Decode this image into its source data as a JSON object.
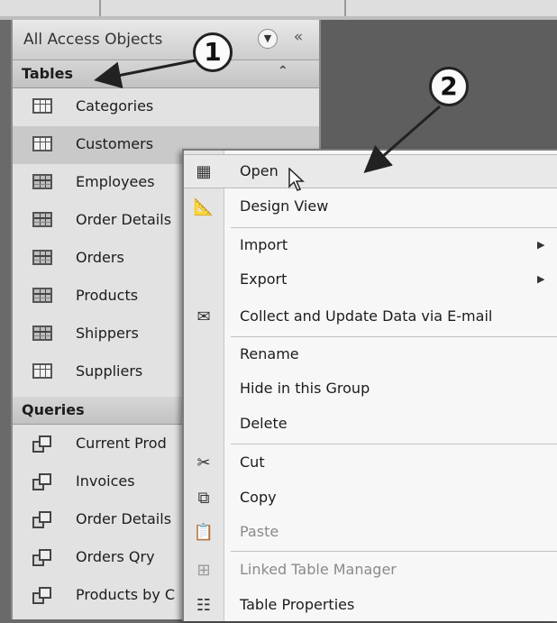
{
  "nav": {
    "title": "All Access Objects",
    "dropdown_icon": "chevron-down-circle-icon",
    "close_icon": "double-chevron-left-icon",
    "groups": [
      {
        "label": "Tables",
        "collapse_icon": "double-chevron-up-icon",
        "items": [
          {
            "label": "Categories",
            "icon": "table-icon"
          },
          {
            "label": "Customers",
            "icon": "table-icon"
          },
          {
            "label": "Employees",
            "icon": "table-icon"
          },
          {
            "label": "Order Details",
            "icon": "table-icon"
          },
          {
            "label": "Orders",
            "icon": "table-icon"
          },
          {
            "label": "Products",
            "icon": "table-icon"
          },
          {
            "label": "Shippers",
            "icon": "table-icon"
          },
          {
            "label": "Suppliers",
            "icon": "table-icon"
          }
        ]
      },
      {
        "label": "Queries",
        "items": [
          {
            "label": "Current Prod",
            "icon": "query-icon"
          },
          {
            "label": "Invoices",
            "icon": "query-icon"
          },
          {
            "label": "Order Details",
            "icon": "query-icon"
          },
          {
            "label": "Orders Qry",
            "icon": "query-icon"
          },
          {
            "label": "Products by C",
            "icon": "query-icon"
          }
        ]
      }
    ],
    "selected_item": "Customers"
  },
  "context_menu": {
    "items": [
      {
        "label": "Open",
        "icon": "open-table-icon",
        "highlighted": true
      },
      {
        "label": "Design View",
        "icon": "design-view-icon"
      },
      {
        "label": "Import",
        "submenu": true
      },
      {
        "label": "Export",
        "submenu": true
      },
      {
        "label": "Collect and Update Data via E-mail",
        "icon": "email-collect-icon"
      },
      {
        "label": "Rename"
      },
      {
        "label": "Hide in this Group"
      },
      {
        "label": "Delete"
      },
      {
        "label": "Cut",
        "icon": "scissors-icon"
      },
      {
        "label": "Copy",
        "icon": "copy-icon"
      },
      {
        "label": "Paste",
        "icon": "paste-icon",
        "disabled": true
      },
      {
        "label": "Linked Table Manager",
        "icon": "linked-table-icon",
        "disabled": true
      },
      {
        "label": "Table Properties",
        "icon": "properties-icon"
      }
    ],
    "submenu_arrow_icon": "triangle-right-icon"
  },
  "callouts": [
    {
      "number": "1"
    },
    {
      "number": "2"
    }
  ],
  "colors": {
    "pane_background": "#e2e2e2",
    "selected_row": "#c9c9c9",
    "menu_background": "#f7f7f7",
    "workspace": "#5e5e5e"
  }
}
